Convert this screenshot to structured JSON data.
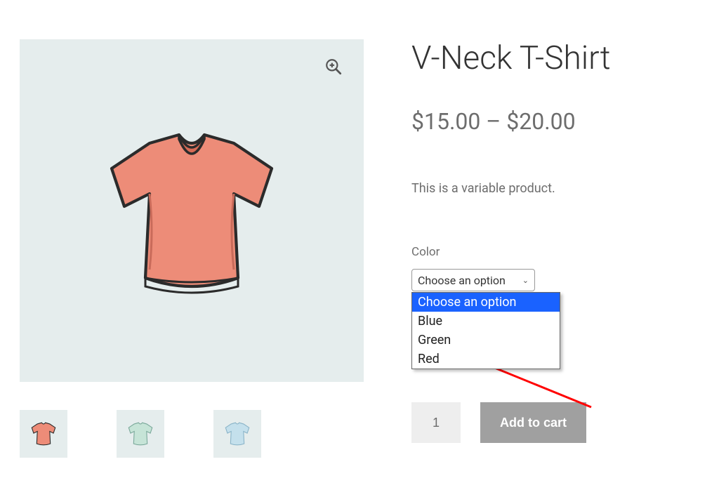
{
  "product": {
    "title": "V-Neck T-Shirt",
    "price_range": "$15.00 – $20.00",
    "short_description": "This is a variable product."
  },
  "variation": {
    "label": "Color",
    "selected_placeholder": "Choose an option",
    "options": [
      "Choose an option",
      "Blue",
      "Green",
      "Red"
    ]
  },
  "cart": {
    "quantity": "1",
    "add_button": "Add to cart"
  },
  "gallery": {
    "thumbs": [
      {
        "name": "red",
        "fill": "#ed8c78"
      },
      {
        "name": "green",
        "fill": "#c6e4d7"
      },
      {
        "name": "blue",
        "fill": "#c4e0ec"
      }
    ],
    "main_fill": "#ed8c78"
  },
  "colors": {
    "highlight": "#1a62ff",
    "button": "#a0a0a0",
    "arrow": "#ff0000"
  }
}
